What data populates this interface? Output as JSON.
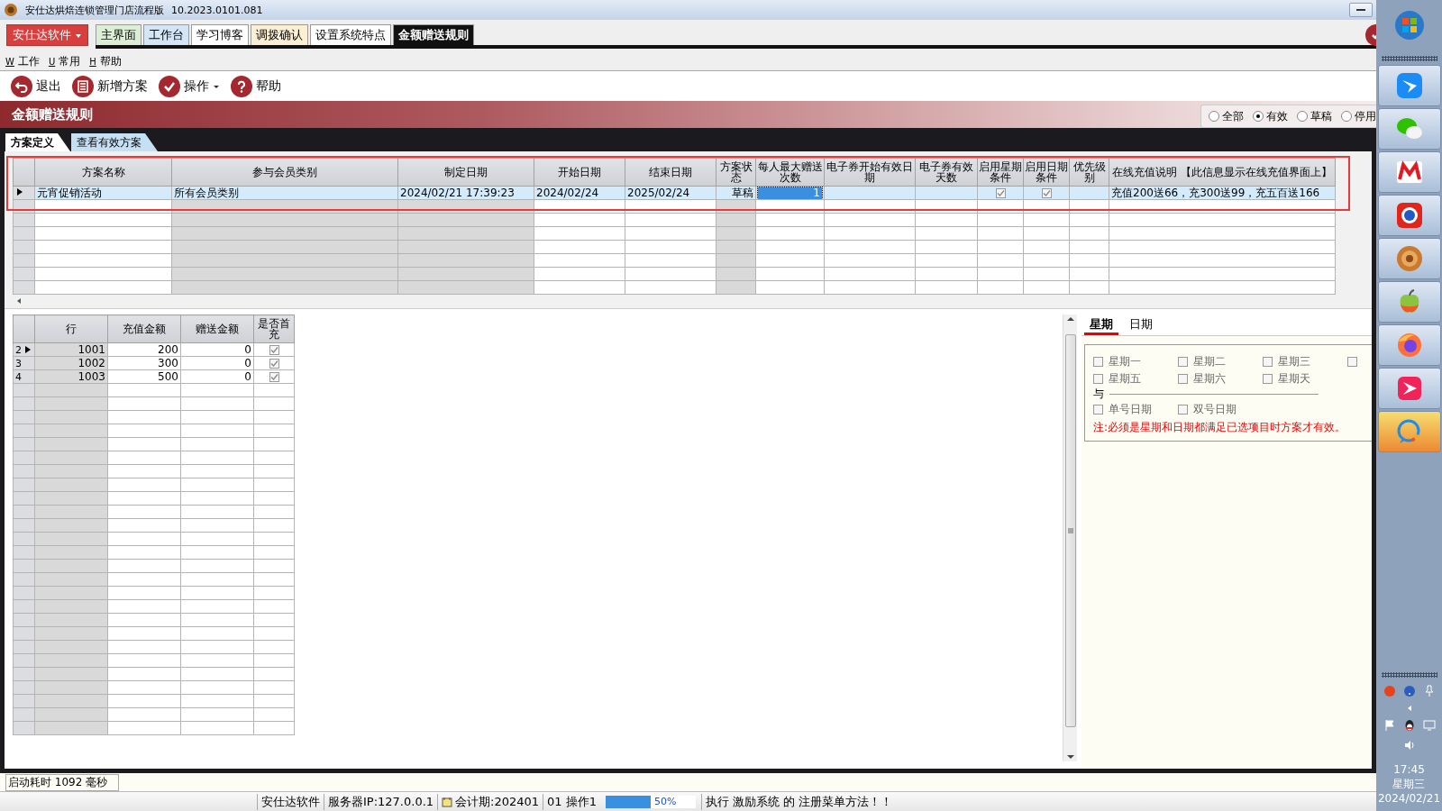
{
  "window": {
    "title": "安仕达烘焙连锁管理门店流程版",
    "version": "10.2023.0101.081"
  },
  "app_menu": {
    "label": "安仕达软件"
  },
  "tabs": [
    {
      "label": "主界面",
      "selected": false,
      "color": "#dcefd6"
    },
    {
      "label": "工作台",
      "selected": false,
      "color": "#d4e5f6"
    },
    {
      "label": "学习博客",
      "selected": false,
      "color": "#ffffff"
    },
    {
      "label": "调拨确认",
      "selected": false,
      "color": "#fcf0d4"
    },
    {
      "label": "设置系统特点",
      "selected": false,
      "color": "#ffffff"
    },
    {
      "label": "金额赠送规则",
      "selected": true
    }
  ],
  "menu": [
    {
      "hotkey": "W",
      "label": "工作"
    },
    {
      "hotkey": "U",
      "label": "常用"
    },
    {
      "hotkey": "H",
      "label": "帮助"
    }
  ],
  "toolbar": [
    {
      "label": "退出",
      "dropdown": false
    },
    {
      "label": "新增方案",
      "dropdown": false
    },
    {
      "label": "操作",
      "dropdown": true
    },
    {
      "label": "帮助",
      "dropdown": false
    }
  ],
  "banner": {
    "title": "金额赠送规则"
  },
  "filter": [
    {
      "label": "全部",
      "selected": false
    },
    {
      "label": "有效",
      "selected": true
    },
    {
      "label": "草稿",
      "selected": false
    },
    {
      "label": "停用",
      "selected": false
    }
  ],
  "sub_tabs": [
    {
      "label": "方案定义",
      "selected": true
    },
    {
      "label": "查看有效方案",
      "selected": false
    }
  ],
  "plans": {
    "columns": [
      {
        "label": "方案名称",
        "readonly": false
      },
      {
        "label": "参与会员类别",
        "readonly": true
      },
      {
        "label": "制定日期",
        "readonly": true
      },
      {
        "label": "开始日期",
        "readonly": false
      },
      {
        "label": "结束日期",
        "readonly": false
      },
      {
        "label": "方案状态",
        "readonly": true
      },
      {
        "label": "每人最大赠送次数",
        "readonly": false
      },
      {
        "label": "电子券开始有效日期",
        "readonly": false
      },
      {
        "label": "电子券有效天数",
        "readonly": false
      },
      {
        "label": "启用星期条件",
        "readonly": false
      },
      {
        "label": "启用日期条件",
        "readonly": false
      },
      {
        "label": "优先级别",
        "readonly": false
      },
      {
        "label": "在线充值说明 【此信息显示在线充值界面上】",
        "readonly": false
      }
    ],
    "rows": [
      {
        "selected": true,
        "current": true,
        "cells": [
          {
            "kind": "text",
            "text": "元宵促销活动",
            "focused": false
          },
          {
            "kind": "text",
            "text": "所有会员类别",
            "focused": false
          },
          {
            "kind": "text",
            "text": "2024/02/21 17:39:23",
            "focused": false
          },
          {
            "kind": "text",
            "text": "2024/02/24",
            "focused": false
          },
          {
            "kind": "text",
            "text": "2025/02/24",
            "focused": false
          },
          {
            "kind": "text",
            "text": "草稿",
            "focused": false
          },
          {
            "kind": "text",
            "text": "1",
            "focused": true
          },
          {
            "kind": "empty"
          },
          {
            "kind": "empty"
          },
          {
            "kind": "check",
            "checked": true
          },
          {
            "kind": "check",
            "checked": true
          },
          {
            "kind": "empty"
          },
          {
            "kind": "text",
            "text": "充值200送66，充300送99，充五百送166",
            "focused": false
          }
        ]
      }
    ]
  },
  "tiers": {
    "columns": [
      "行",
      "充值金额",
      "赠送金额",
      "是否首充"
    ],
    "rows": [
      {
        "index": "2",
        "current": true,
        "row": "1001",
        "amount": "200",
        "bonus": "0",
        "first_charge": true
      },
      {
        "index": "3",
        "current": false,
        "row": "1002",
        "amount": "300",
        "bonus": "0",
        "first_charge": true
      },
      {
        "index": "4",
        "current": false,
        "row": "1003",
        "amount": "500",
        "bonus": "0",
        "first_charge": true
      }
    ]
  },
  "schedule": {
    "tabs": [
      {
        "label": "星期",
        "selected": true
      },
      {
        "label": "日期",
        "selected": false
      }
    ],
    "weekdays": [
      {
        "label": "星期一",
        "checked": false
      },
      {
        "label": "星期二",
        "checked": false
      },
      {
        "label": "星期三",
        "checked": false
      },
      {
        "checked": false
      },
      {
        "label": "星期五",
        "checked": false
      },
      {
        "label": "星期六",
        "checked": false
      },
      {
        "label": "星期天",
        "checked": false
      }
    ],
    "separator": "与",
    "parity": [
      {
        "label": "单号日期",
        "checked": false
      },
      {
        "label": "双号日期",
        "checked": false
      }
    ],
    "note": "注:必须是星期和日期都满足已选项目时方案才有效。"
  },
  "startup": "启动耗时 1092 毫秒",
  "status_bar": {
    "company": "安仕达软件",
    "server": "服务器IP:127.0.0.1",
    "period": "会计期:202401",
    "operator": "01 操作1",
    "progress": {
      "level": 0.5,
      "label": "50%"
    },
    "message": "执行 激励系统 的 注册菜单方法！！"
  },
  "tray": {
    "time": "17:45",
    "weekday": "星期三",
    "date": "2024/02/21"
  }
}
